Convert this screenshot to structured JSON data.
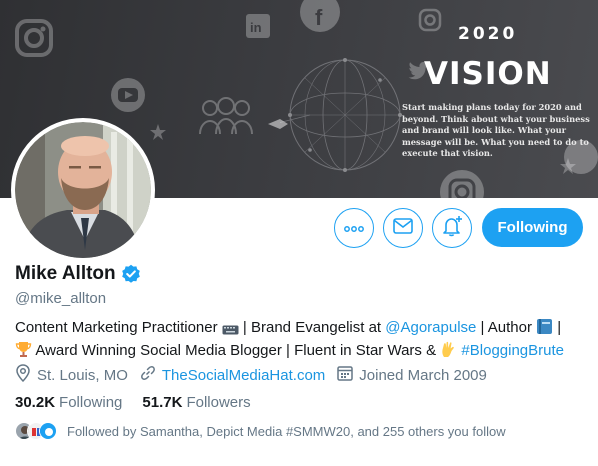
{
  "banner": {
    "year": "2020",
    "headline": "VISION",
    "tagline": "Start making plans today for 2020 and beyond. Think about what your business and brand will look like. What your message will be. What you need to do to execute that vision."
  },
  "profile": {
    "name": "Mike Allton",
    "handle": "@mike_allton",
    "verified": true
  },
  "actions": {
    "following_label": "Following"
  },
  "bio": {
    "part1": "Content Marketing Practitioner ",
    "part2": " | Brand Evangelist at ",
    "mention": "@Agorapulse",
    "part3": " | Author ",
    "part4": " |",
    "part5": " Award Winning Social Media Blogger | Fluent in Star Wars & ",
    "hashtag": "#BloggingBrute"
  },
  "meta": {
    "location": "St. Louis, MO",
    "website": "TheSocialMediaHat.com",
    "joined": "Joined March 2009"
  },
  "stats": {
    "following_count": "30.2K",
    "following_label": "Following",
    "followers_count": "51.7K",
    "followers_label": "Followers"
  },
  "followed_by": "Followed by Samantha, Depict Media #SMMW20, and 255 others you follow",
  "colors": {
    "accent": "#1da1f2",
    "link": "#1b95e0",
    "secondary_text": "#657786",
    "banner_bg": "#3b3c40"
  },
  "icons": [
    "instagram-icon",
    "facebook-icon",
    "linkedin-icon",
    "youtube-icon",
    "twitter-bird-icon",
    "star-icon",
    "more-icon",
    "mail-icon",
    "bell-plus-icon",
    "verified-badge-icon",
    "location-icon",
    "link-icon",
    "calendar-icon"
  ]
}
